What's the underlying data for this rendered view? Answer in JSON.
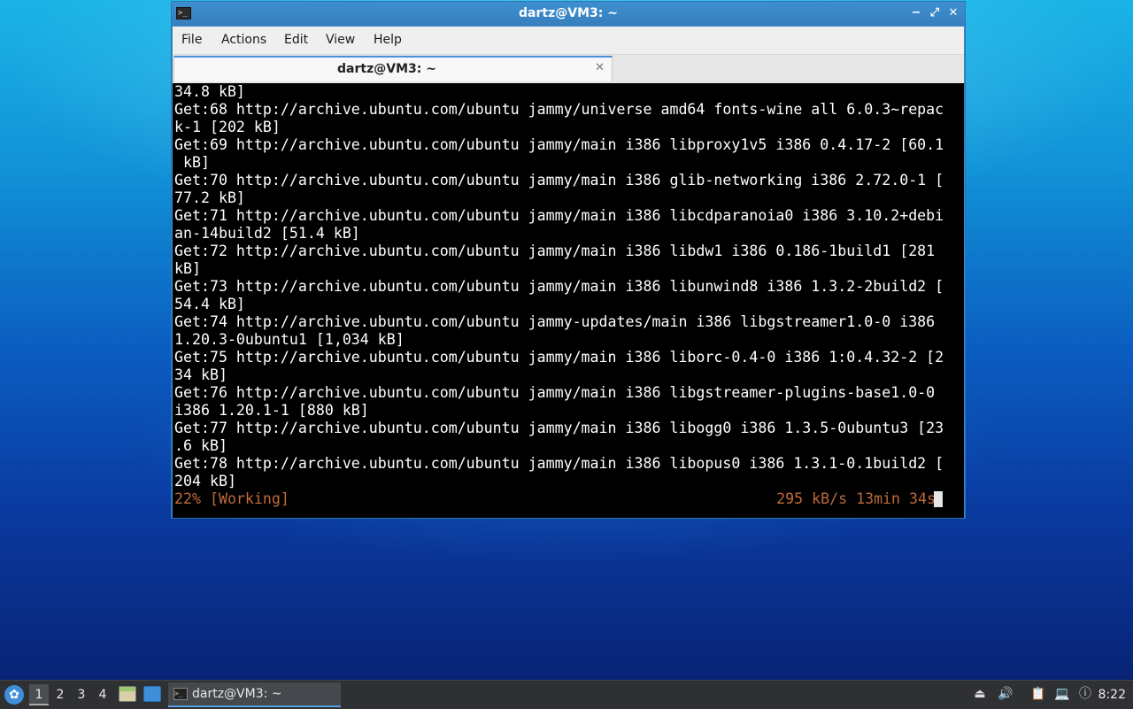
{
  "window": {
    "title": "dartz@VM3: ~",
    "controls": {
      "minimize": "−",
      "maximize": "⤢",
      "close": "✕"
    }
  },
  "menubar": [
    "File",
    "Actions",
    "Edit",
    "View",
    "Help"
  ],
  "tab": {
    "label": "dartz@VM3: ~",
    "close": "✕"
  },
  "terminal": {
    "lines": [
      "34.8 kB]",
      "Get:68 http://archive.ubuntu.com/ubuntu jammy/universe amd64 fonts-wine all 6.0.3~repac",
      "k-1 [202 kB]",
      "Get:69 http://archive.ubuntu.com/ubuntu jammy/main i386 libproxy1v5 i386 0.4.17-2 [60.1",
      " kB]",
      "Get:70 http://archive.ubuntu.com/ubuntu jammy/main i386 glib-networking i386 2.72.0-1 [",
      "77.2 kB]",
      "Get:71 http://archive.ubuntu.com/ubuntu jammy/main i386 libcdparanoia0 i386 3.10.2+debi",
      "an-14build2 [51.4 kB]",
      "Get:72 http://archive.ubuntu.com/ubuntu jammy/main i386 libdw1 i386 0.186-1build1 [281",
      "kB]",
      "Get:73 http://archive.ubuntu.com/ubuntu jammy/main i386 libunwind8 i386 1.3.2-2build2 [",
      "54.4 kB]",
      "Get:74 http://archive.ubuntu.com/ubuntu jammy-updates/main i386 libgstreamer1.0-0 i386",
      "1.20.3-0ubuntu1 [1,034 kB]",
      "Get:75 http://archive.ubuntu.com/ubuntu jammy/main i386 liborc-0.4-0 i386 1:0.4.32-2 [2",
      "34 kB]",
      "Get:76 http://archive.ubuntu.com/ubuntu jammy/main i386 libgstreamer-plugins-base1.0-0",
      "i386 1.20.1-1 [880 kB]",
      "Get:77 http://archive.ubuntu.com/ubuntu jammy/main i386 libogg0 i386 1.3.5-0ubuntu3 [23",
      ".6 kB]",
      "Get:78 http://archive.ubuntu.com/ubuntu jammy/main i386 libopus0 i386 1.3.1-0.1build2 [",
      "204 kB]"
    ],
    "status_left": "22% [Working]",
    "status_right": "295 kB/s 13min 34s"
  },
  "taskbar": {
    "workspaces": [
      "1",
      "2",
      "3",
      "4"
    ],
    "active_workspace": "1",
    "task": {
      "label": "dartz@VM3: ~"
    },
    "clock": "8:22"
  },
  "colors": {
    "titlebar": "#3a88c8",
    "terminal_bg": "#000000",
    "terminal_fg": "#ffffff",
    "status_fg": "#c06a3a",
    "taskbar_bg": "#2e3033"
  }
}
